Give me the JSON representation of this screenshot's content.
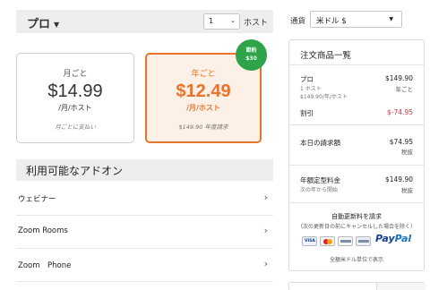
{
  "plan": {
    "name": "プロ",
    "host_count": "1",
    "host_label": "ホスト"
  },
  "pricing": {
    "monthly": {
      "period": "月ごと",
      "price": "$14.99",
      "unit": "/月/ホスト",
      "note": "月ごとに支払い"
    },
    "annual": {
      "period": "年ごと",
      "price": "$12.49",
      "unit": "/月/ホスト",
      "note": "$149.90 年度請求"
    },
    "badge": {
      "line1": "節約",
      "line2": "$30",
      "color": "#2ea34a"
    },
    "accent_color": "#e8742b"
  },
  "addons": {
    "title": "利用可能なアドオン",
    "items": [
      {
        "label": "ウェビナー"
      },
      {
        "label": "Zoom Rooms"
      },
      {
        "label": "Zoom　Phone"
      }
    ]
  },
  "currency": {
    "label": "通貨",
    "selected": "米ドル $"
  },
  "summary": {
    "title": "注文商品一覧",
    "plan_name": "プロ",
    "plan_hosts": "1 ホスト",
    "plan_rate": "$149.90/年/ホスト",
    "plan_price": "$149.90",
    "plan_period": "年ごと",
    "discount_label": "割引",
    "discount_value": "$-74.95",
    "today_label": "本日の請求額",
    "today_value": "$74.95",
    "today_tax": "税抜",
    "recurring_label": "年額定型料金",
    "recurring_sub": "次の年から開始",
    "recurring_value": "$149.90",
    "recurring_tax": "税抜",
    "auto_renew": "自動更新料を請求",
    "auto_renew_sub": "（次の更新日の前にキャンセルした場合を除く）",
    "paypal_a": "Pay",
    "paypal_b": "Pal",
    "card_visa": "VISA",
    "currency_note": "全額米ドル単位で表示",
    "discount_color": "#d9303a"
  }
}
